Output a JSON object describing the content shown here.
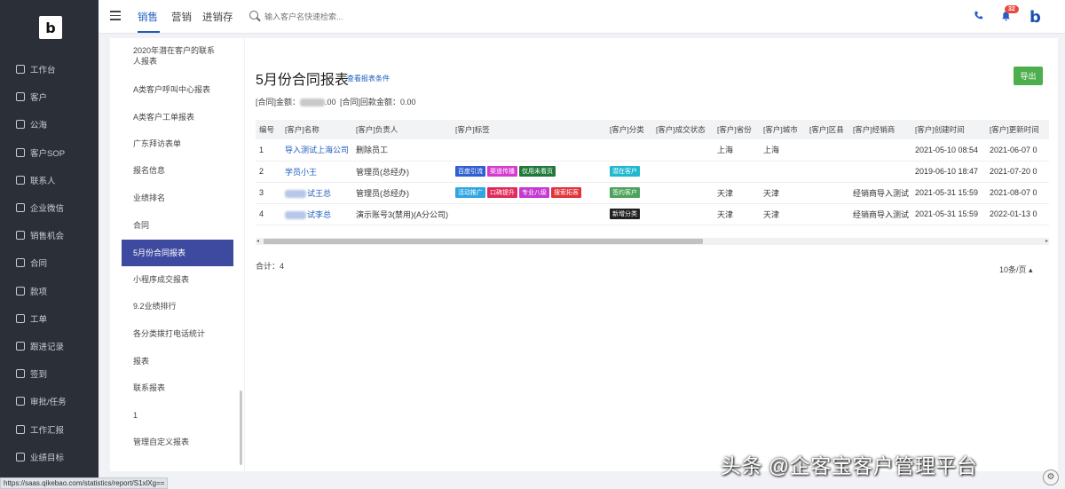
{
  "nav": {
    "items": [
      {
        "label": "工作台",
        "icon": "dashboard-icon"
      },
      {
        "label": "客户",
        "icon": "customer-icon"
      },
      {
        "label": "公海",
        "icon": "sea-icon"
      },
      {
        "label": "客户SOP",
        "icon": "sop-icon"
      },
      {
        "label": "联系人",
        "icon": "contact-icon"
      },
      {
        "label": "企业微信",
        "icon": "wechat-icon"
      },
      {
        "label": "销售机会",
        "icon": "opportunity-icon"
      },
      {
        "label": "合同",
        "icon": "contract-icon"
      },
      {
        "label": "款项",
        "icon": "payment-icon"
      },
      {
        "label": "工单",
        "icon": "ticket-icon"
      },
      {
        "label": "跟进记录",
        "icon": "followup-icon"
      },
      {
        "label": "签到",
        "icon": "checkin-icon"
      },
      {
        "label": "审批/任务",
        "icon": "approval-icon"
      },
      {
        "label": "工作汇报",
        "icon": "report-icon"
      },
      {
        "label": "业绩目标",
        "icon": "target-icon"
      }
    ]
  },
  "topbar": {
    "tabs": [
      "销售",
      "营销",
      "进销存"
    ],
    "search_placeholder": "输入客户名快速检索...",
    "notification_count": "32"
  },
  "report_list": [
    "2020年潜在客户的联系人报表",
    "A类客户呼叫中心报表",
    "A类客户工单报表",
    "广东拜访表单",
    "报名信息",
    "业绩排名",
    "合同",
    "5月份合同报表",
    "小程序成交报表",
    "9.2业绩排行",
    "各分类拨打电话统计",
    "报表",
    "联系报表",
    "1",
    "管理自定义报表"
  ],
  "report": {
    "title": "5月份合同报表",
    "filter_link": "查看报表条件",
    "export_label": "导出",
    "amount_label": "[合同]金额：",
    "amount_suffix": ".00",
    "received_label": "[合同]回款金额：0.00",
    "columns": [
      "编号",
      "[客户]名称",
      "[客户]负责人",
      "[客户]标签",
      "[客户]分类",
      "[客户]成交状态",
      "[客户]省份",
      "[客户]城市",
      "[客户]区县",
      "[客户]经销商",
      "[客户]创建时间",
      "[客户]更新时间"
    ],
    "rows": [
      {
        "no": "1",
        "name": "导入测试上海公司",
        "owner": "删除员工",
        "tags": [],
        "category": "",
        "status": "",
        "province": "上海",
        "city": "上海",
        "district": "",
        "dealer": "",
        "created": "2021-05-10 08:54",
        "updated": "2021-06-07 0"
      },
      {
        "no": "2",
        "name": "学员小王",
        "owner": "管理员(总经办)",
        "tags": [
          {
            "text": "百度引流",
            "color": "#2f5fd0"
          },
          {
            "text": "渠道传播",
            "color": "#d63bd0"
          },
          {
            "text": "仅用未看页",
            "color": "#1f7a3a"
          }
        ],
        "category": "潜在客户",
        "category_color": "#1fb8d0",
        "status": "",
        "province": "",
        "city": "",
        "district": "",
        "dealer": "",
        "created": "2019-06-10 18:47",
        "updated": "2021-07-20 0"
      },
      {
        "no": "3",
        "name": "试王总",
        "owner": "管理员(总经办)",
        "tags": [
          {
            "text": "活动推广",
            "color": "#2fa6e0"
          },
          {
            "text": "口碑提升",
            "color": "#e02a5a"
          },
          {
            "text": "专业八级",
            "color": "#c43ad0"
          },
          {
            "text": "搜索拓客",
            "color": "#e0333a"
          }
        ],
        "category": "签约客户",
        "category_color": "#4ca25a",
        "status": "",
        "province": "天津",
        "city": "天津",
        "district": "",
        "dealer": "经销商导入测试",
        "created": "2021-05-31 15:59",
        "updated": "2021-08-07 0"
      },
      {
        "no": "4",
        "name": "试李总",
        "owner": "演示账号3(禁用)(A分公司)",
        "tags": [],
        "category": "新增分类",
        "category_color": "#222222",
        "status": "",
        "province": "天津",
        "city": "天津",
        "district": "",
        "dealer": "经销商导入测试",
        "created": "2021-05-31 15:59",
        "updated": "2022-01-13 0"
      }
    ],
    "total_label": "合计：4",
    "page_size": "10条/页"
  },
  "status_url": "https://saas.qikebao.com/statistics/report/S1xlXg==",
  "watermark": "头条 @企客宝客户管理平台",
  "colors": {
    "nav_bg": "#2b3038",
    "accent": "#3d4aa0",
    "link": "#1e5dbf",
    "export": "#4cae4c"
  }
}
